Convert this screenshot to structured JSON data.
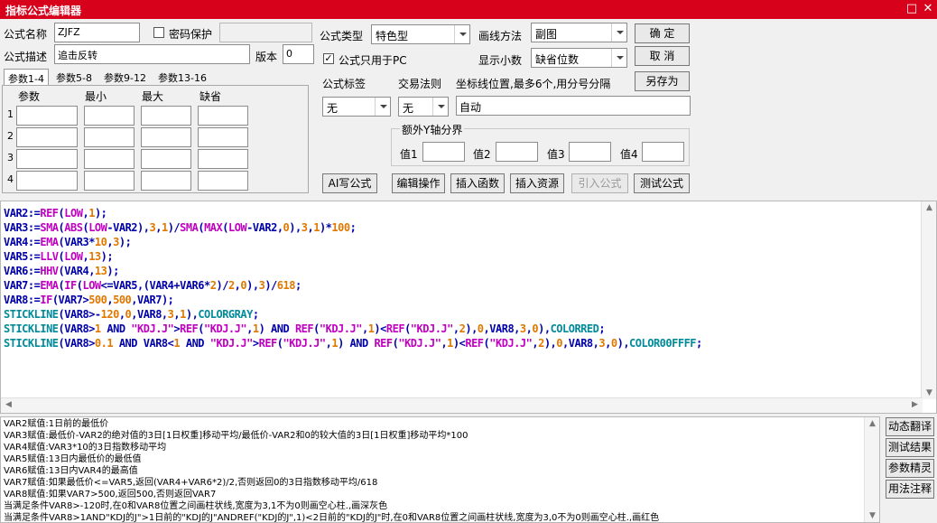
{
  "window": {
    "title": "指标公式编辑器",
    "restore_glyph": "□",
    "close_glyph": "✕"
  },
  "form": {
    "formula_name_label": "公式名称",
    "formula_name_value": "ZJFZ",
    "password_label": "密码保护",
    "password_checked": false,
    "formula_desc_label": "公式描述",
    "formula_desc_value": "追击反转",
    "version_label": "版本",
    "version_value": "0",
    "formula_type_label": "公式类型",
    "formula_type_value": "特色型",
    "draw_method_label": "画线方法",
    "draw_method_value": "副图",
    "pc_only_label": "公式只用于PC",
    "pc_only_checked": true,
    "decimals_label": "显示小数",
    "decimals_value": "缺省位数",
    "ok_button": "确  定",
    "cancel_button": "取  消",
    "save_as_button": "另存为",
    "formula_tag_label": "公式标签",
    "formula_tag_value": "无",
    "trade_rule_label": "交易法则",
    "trade_rule_value": "无",
    "coord_label": "坐标线位置,最多6个,用分号分隔",
    "coord_value": "自动",
    "extra_y_label": "额外Y轴分界",
    "value_labels": [
      "值1",
      "值2",
      "值3",
      "值4"
    ]
  },
  "params": {
    "tabs": [
      "参数1-4",
      "参数5-8",
      "参数9-12",
      "参数13-16"
    ],
    "headers": [
      "参数",
      "最小",
      "最大",
      "缺省"
    ],
    "rows": [
      "1",
      "2",
      "3",
      "4"
    ]
  },
  "actions": {
    "ai_button": "AI写公式",
    "edit_op_button": "编辑操作",
    "insert_func_button": "插入函数",
    "insert_res_button": "插入资源",
    "import_formula_button": "引入公式",
    "test_formula_button": "测试公式"
  },
  "code_lines": [
    "VAR2:=REF(LOW,1);",
    "VAR3:=SMA(ABS(LOW-VAR2),3,1)/SMA(MAX(LOW-VAR2,0),3,1)*100;",
    "VAR4:=EMA(VAR3*10,3);",
    "VAR5:=LLV(LOW,13);",
    "VAR6:=HHV(VAR4,13);",
    "VAR7:=EMA(IF(LOW<=VAR5,(VAR4+VAR6*2)/2,0),3)/618;",
    "VAR8:=IF(VAR7>500,500,VAR7);",
    "STICKLINE(VAR8>-120,0,VAR8,3,1),COLORGRAY;",
    "STICKLINE(VAR8>1 AND \"KDJ.J\">REF(\"KDJ.J\",1) AND REF(\"KDJ.J\",1)<REF(\"KDJ.J\",2),0,VAR8,3,0),COLORRED;",
    "STICKLINE(VAR8>0.1 AND VAR8<1 AND \"KDJ.J\">REF(\"KDJ.J\",1) AND REF(\"KDJ.J\",1)<REF(\"KDJ.J\",2),0,VAR8,3,0),COLOR00FFFF;"
  ],
  "description_lines": [
    "VAR2赋值:1日前的最低价",
    "VAR3赋值:最低价-VAR2的绝对值的3日[1日权重]移动平均/最低价-VAR2和0的较大值的3日[1日权重]移动平均*100",
    "VAR4赋值:VAR3*10的3日指数移动平均",
    "VAR5赋值:13日内最低价的最低值",
    "VAR6赋值:13日内VAR4的最高值",
    "VAR7赋值:如果最低价<=VAR5,返回(VAR4+VAR6*2)/2,否则返回0的3日指数移动平均/618",
    "VAR8赋值:如果VAR7>500,返回500,否则返回VAR7",
    "当满足条件VAR8>-120时,在0和VAR8位置之间画柱状线,宽度为3,1不为0则画空心柱.,画深灰色",
    "当满足条件VAR8>1AND\"KDJ的J\">1日前的\"KDJ的J\"ANDREF(\"KDJ的J\",1)<2日前的\"KDJ的J\"时,在0和VAR8位置之间画柱状线,宽度为3,0不为0则画空心柱.,画红色"
  ],
  "side_buttons": [
    "动态翻译",
    "测试结果",
    "参数精灵",
    "用法注释"
  ],
  "colors": {
    "titlebar": "#d7011b",
    "keyword": "#0000cc",
    "function": "#c000c0",
    "number": "#e07800",
    "draw": "#008a9a"
  }
}
